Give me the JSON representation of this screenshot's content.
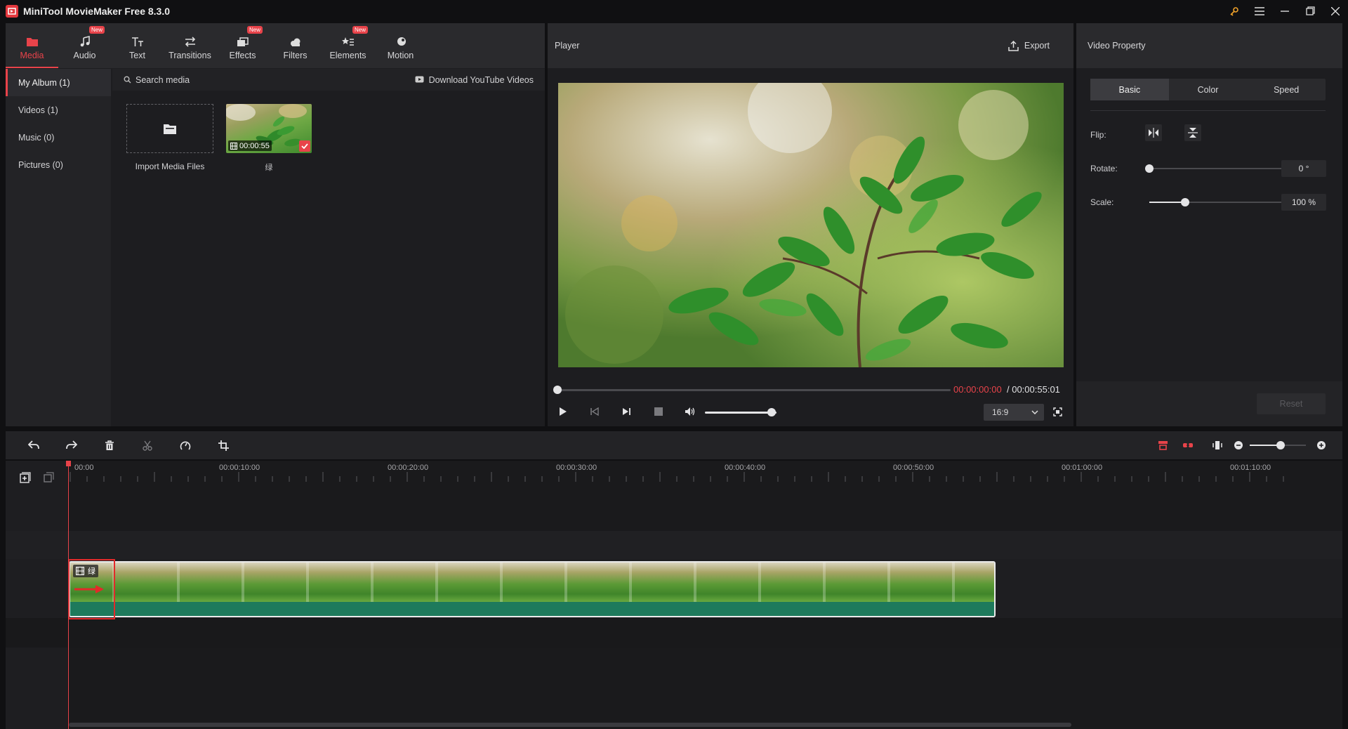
{
  "app": {
    "title": "MiniTool MovieMaker Free 8.3.0"
  },
  "toolbar": {
    "tabs": [
      {
        "label": "Media",
        "icon": "folder-icon",
        "new": false,
        "active": true
      },
      {
        "label": "Audio",
        "icon": "music-note-icon",
        "new": true
      },
      {
        "label": "Text",
        "icon": "text-icon",
        "new": false
      },
      {
        "label": "Transitions",
        "icon": "swap-arrows-icon",
        "new": false
      },
      {
        "label": "Effects",
        "icon": "effects-icon",
        "new": true
      },
      {
        "label": "Filters",
        "icon": "cloud-icon",
        "new": false
      },
      {
        "label": "Elements",
        "icon": "elements-icon",
        "new": true
      },
      {
        "label": "Motion",
        "icon": "motion-icon",
        "new": false
      }
    ],
    "new_badge": "New"
  },
  "album": {
    "items": [
      {
        "label": "My Album (1)",
        "active": true
      },
      {
        "label": "Videos (1)"
      },
      {
        "label": "Music (0)"
      },
      {
        "label": "Pictures (0)"
      }
    ]
  },
  "media": {
    "search_label": "Search media",
    "download_label": "Download YouTube Videos",
    "import_label": "Import Media Files",
    "clip": {
      "duration": "00:00:55",
      "name": "绿"
    }
  },
  "player": {
    "title": "Player",
    "export_label": "Export",
    "time_current": "00:00:00:00",
    "time_total": "/ 00:00:55:01",
    "progress": 0,
    "volume": 0.93,
    "aspect_ratio": "16:9"
  },
  "property": {
    "title": "Video Property",
    "tabs": [
      {
        "label": "Basic",
        "active": true
      },
      {
        "label": "Color"
      },
      {
        "label": "Speed"
      }
    ],
    "flip_label": "Flip:",
    "rotate_label": "Rotate:",
    "rotate_value": "0 °",
    "rotate_level": 0,
    "scale_label": "Scale:",
    "scale_value": "100 %",
    "scale_level": 0.27,
    "reset_label": "Reset"
  },
  "timeline": {
    "ruler_labels": [
      "00:00",
      "00:00:10:00",
      "00:00:20:00",
      "00:00:30:00",
      "00:00:40:00",
      "00:00:50:00",
      "00:01:00:00",
      "00:01:10:00"
    ],
    "clip_name": "绿",
    "zoom_level": 0.55
  },
  "colors": {
    "accent": "#e8434a",
    "highlight": "#e22a2a"
  }
}
